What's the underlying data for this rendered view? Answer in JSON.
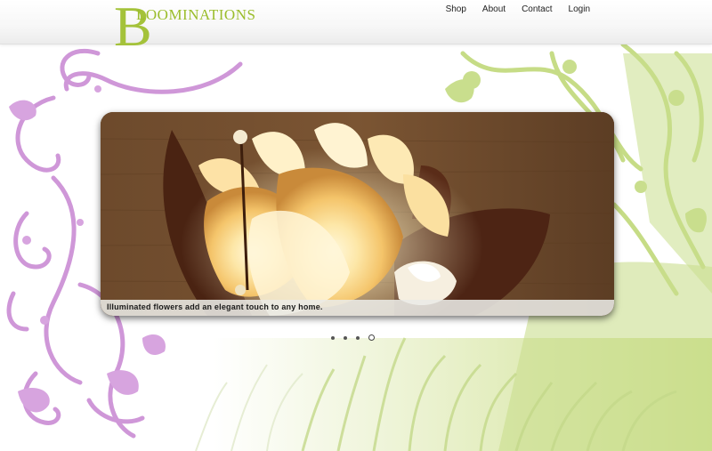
{
  "brand": {
    "logo_letter": "B",
    "logo_name": "LOOMINATIONS",
    "accent_color": "#a4c23a"
  },
  "nav": {
    "items": [
      {
        "label": "Shop"
      },
      {
        "label": "About"
      },
      {
        "label": "Contact"
      },
      {
        "label": "Login"
      }
    ]
  },
  "slider": {
    "caption": "Illuminated flowers add an elegant touch to any home.",
    "slide_count": 4,
    "active_slide": 4
  },
  "decor": {
    "left_swirl_color": "#c98ed3",
    "right_foliage_color": "#b9d46a",
    "left_swirl_icon": "floral-swirl-icon",
    "right_foliage_icon": "grass-foliage-icon"
  }
}
